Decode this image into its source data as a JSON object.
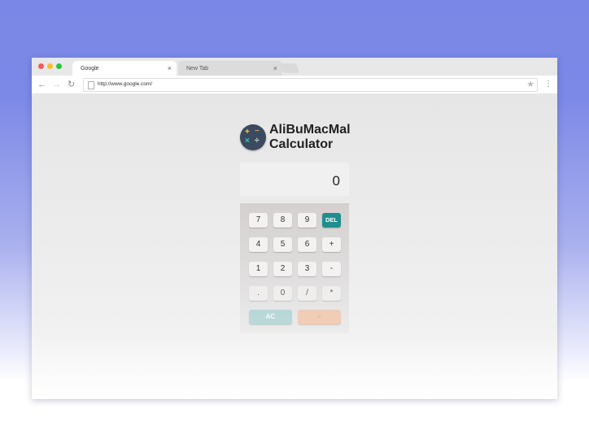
{
  "browser": {
    "tabs": [
      {
        "label": "Google",
        "close": "×"
      },
      {
        "label": "New Tab",
        "close": "×"
      }
    ],
    "url": "http://www.google.com/",
    "nav": {
      "back": "←",
      "forward": "→",
      "reload": "↻",
      "star": "★",
      "menu": "⋮"
    }
  },
  "app": {
    "title_line1": "AliBuMacMal",
    "title_line2": "Calculator",
    "logo_ops": {
      "plus": "+",
      "minus": "−",
      "times": "×",
      "divide": "÷"
    }
  },
  "display": {
    "value": "0"
  },
  "keys": {
    "k7": "7",
    "k8": "8",
    "k9": "9",
    "del": "DEL",
    "k4": "4",
    "k5": "5",
    "k6": "6",
    "plus": "+",
    "k1": "1",
    "k2": "2",
    "k3": "3",
    "minus": "-",
    "dot": ".",
    "k0": "0",
    "div": "/",
    "mul": "*",
    "ac": "AC",
    "eq": "="
  },
  "colors": {
    "background_top": "#7b87e6",
    "del_button": "#1e8f8f",
    "ac_button": "#a9d4d4",
    "equals_button": "#f4c4a6",
    "logo_bg": "#3b4a5f"
  }
}
